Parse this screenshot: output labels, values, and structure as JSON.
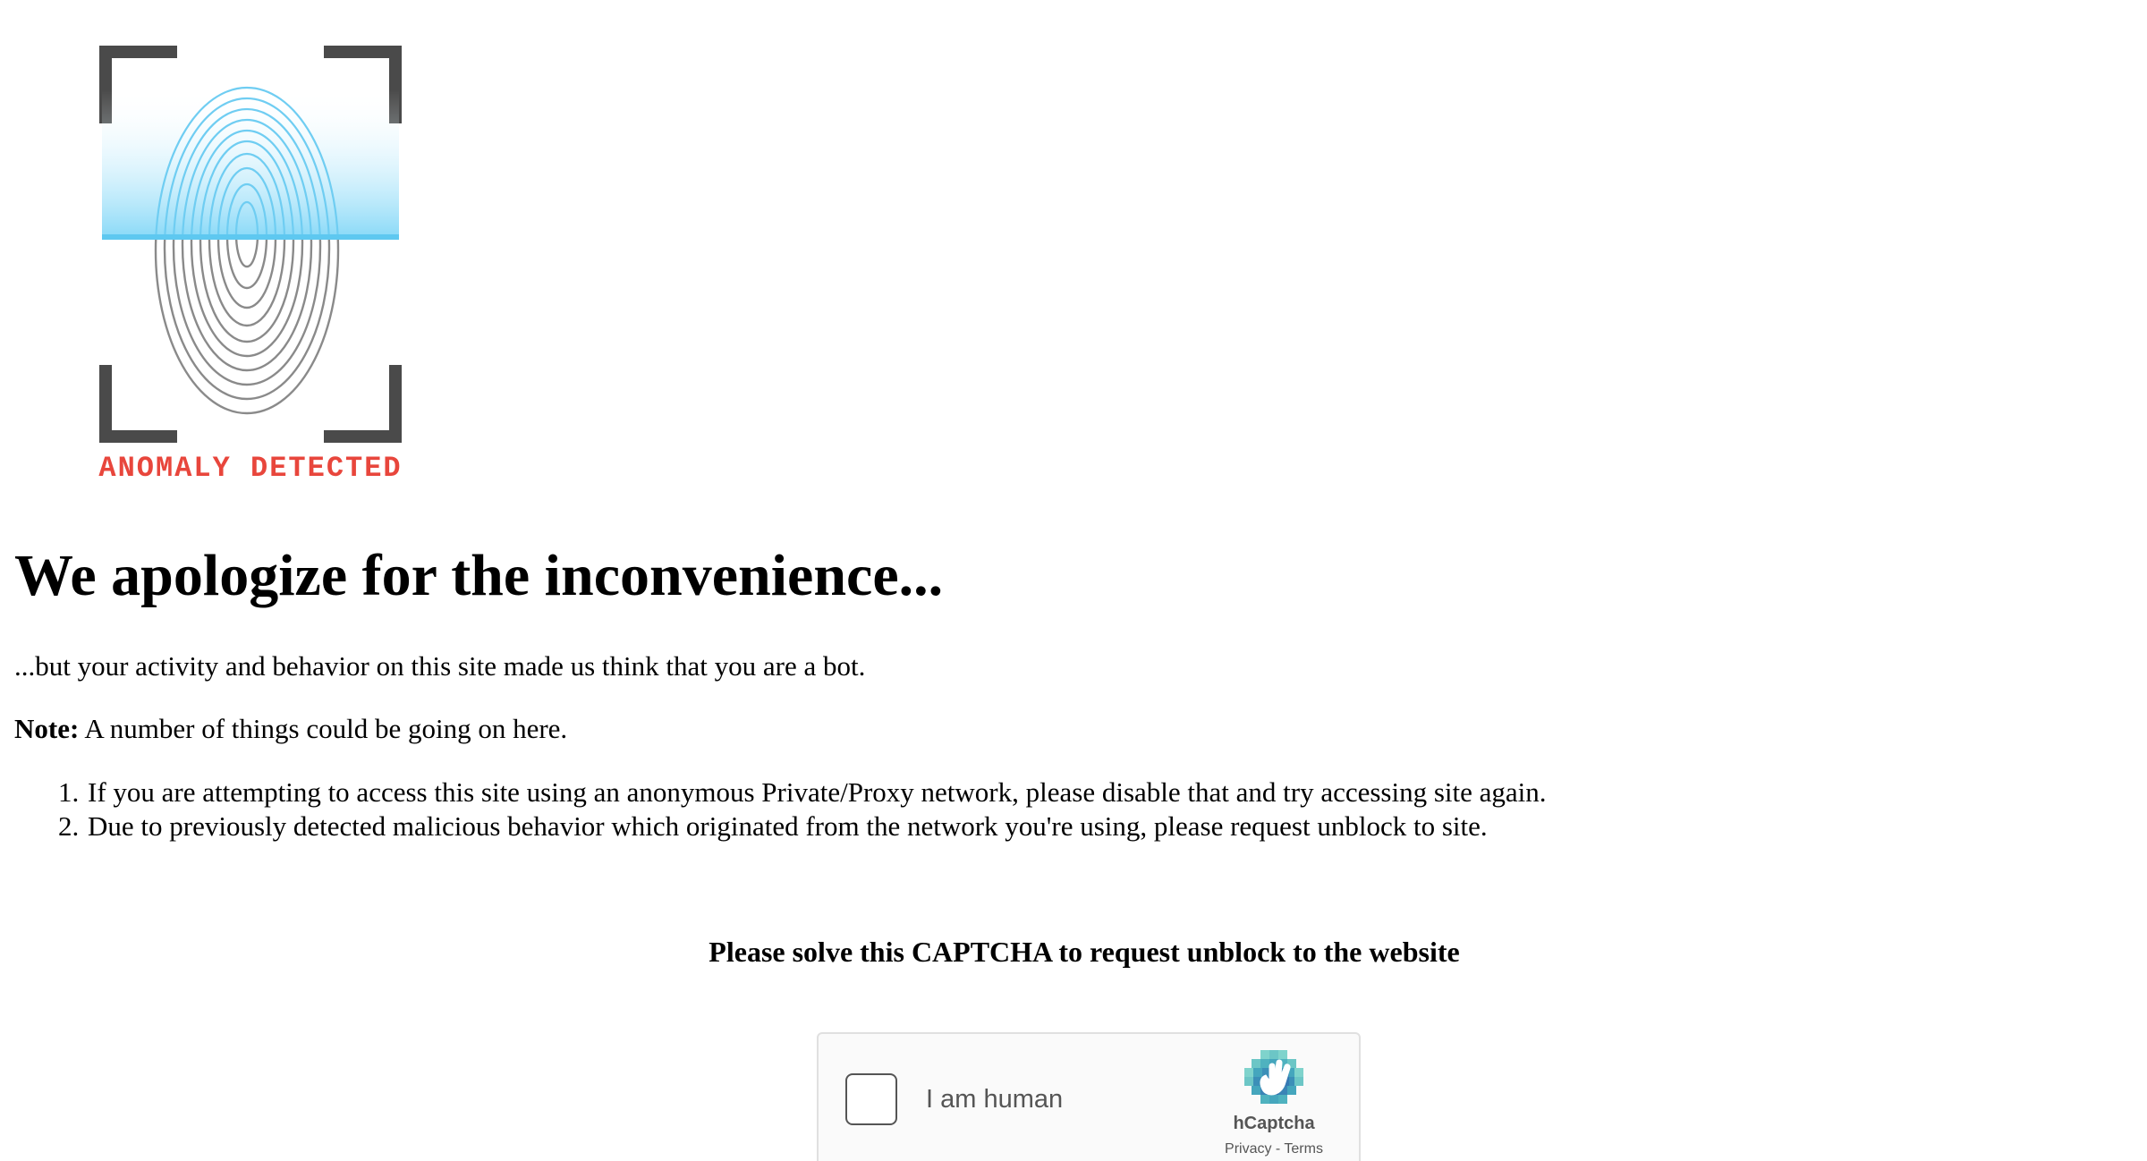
{
  "logo": {
    "icon": "fingerprint-scan-icon",
    "caption": "ANOMALY DETECTED",
    "caption_color": "#e8463c",
    "scan_color": "#5ec8f0"
  },
  "headline": "We apologize for the inconvenience...",
  "intro": "...but your activity and behavior on this site made us think that you are a bot.",
  "note": {
    "label": "Note:",
    "text": " A number of things could be going on here."
  },
  "reasons": [
    "If you are attempting to access this site using an anonymous Private/Proxy network, please disable that and try accessing site again.",
    "Due to previously detected malicious behavior which originated from the network you're using, please request unblock to site."
  ],
  "captcha": {
    "title": "Please solve this CAPTCHA to request unblock to the website",
    "checkbox_label": "I am human",
    "brand": "hCaptcha",
    "brand_icon": "hcaptcha-hand-icon",
    "privacy_link": "Privacy",
    "separator": " - ",
    "terms_link": "Terms"
  }
}
